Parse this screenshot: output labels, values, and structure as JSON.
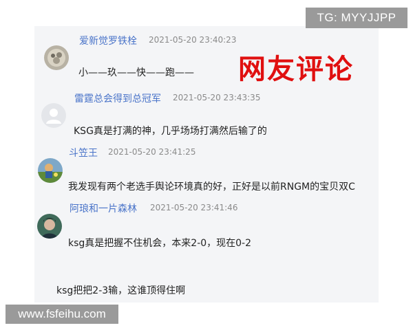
{
  "watermarks": {
    "top": "TG: MYYJJPP",
    "bottom": "www.fsfeihu.com"
  },
  "banner": "网友评论",
  "comments": [
    {
      "user": "爱新觉罗铁栓",
      "time": "2021-05-20 23:40:23",
      "text": "小——玖——快——跑——"
    },
    {
      "user": "雷霆总会得到总冠军",
      "time": "2021-05-20 23:43:35",
      "text": "KSG真是打满的神，几乎场场打满然后输了的"
    },
    {
      "user": "斗笠王",
      "time": "2021-05-20 23:41:25",
      "text": "我发现有两个老选手舆论环境真的好，正好是以前RNGM的宝贝双C"
    },
    {
      "user": "阿琅和一片森林",
      "time": "2021-05-20 23:41:46",
      "text": "ksg真是把握不住机会，本来2-0，现在0-2"
    }
  ],
  "extra_text": "ksg把把2-3输，这谁顶得住啊",
  "colors": {
    "username": "#4a74c9",
    "banner": "#e01010",
    "watermark_bg": "#9a9a9a"
  }
}
